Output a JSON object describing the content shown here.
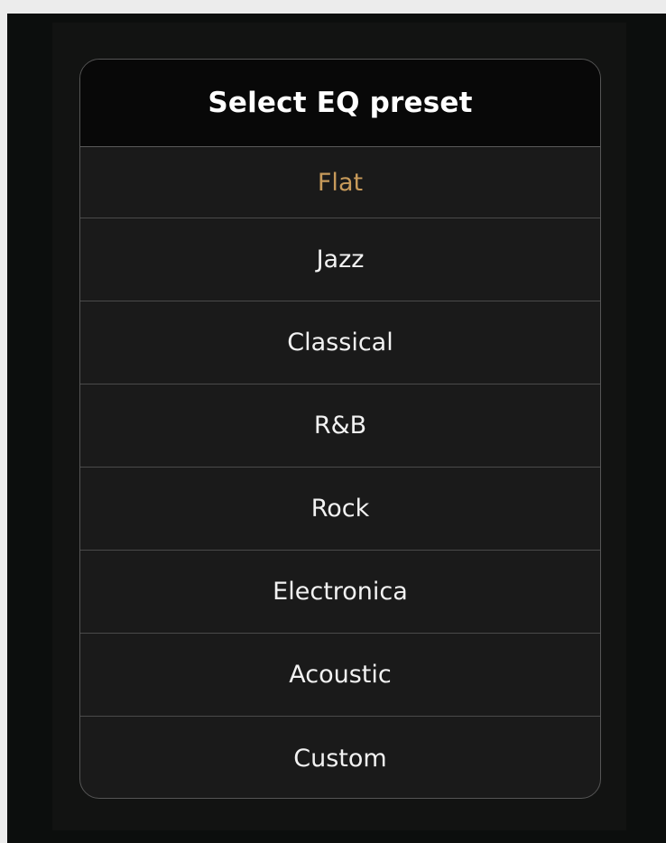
{
  "dialog": {
    "title": "Select EQ preset",
    "selected_color": "#c79a5a",
    "presets": [
      {
        "label": "Flat",
        "selected": true
      },
      {
        "label": "Jazz",
        "selected": false
      },
      {
        "label": "Classical",
        "selected": false
      },
      {
        "label": "R&B",
        "selected": false
      },
      {
        "label": "Rock",
        "selected": false
      },
      {
        "label": "Electronica",
        "selected": false
      },
      {
        "label": "Acoustic",
        "selected": false
      },
      {
        "label": "Custom",
        "selected": false
      }
    ]
  }
}
